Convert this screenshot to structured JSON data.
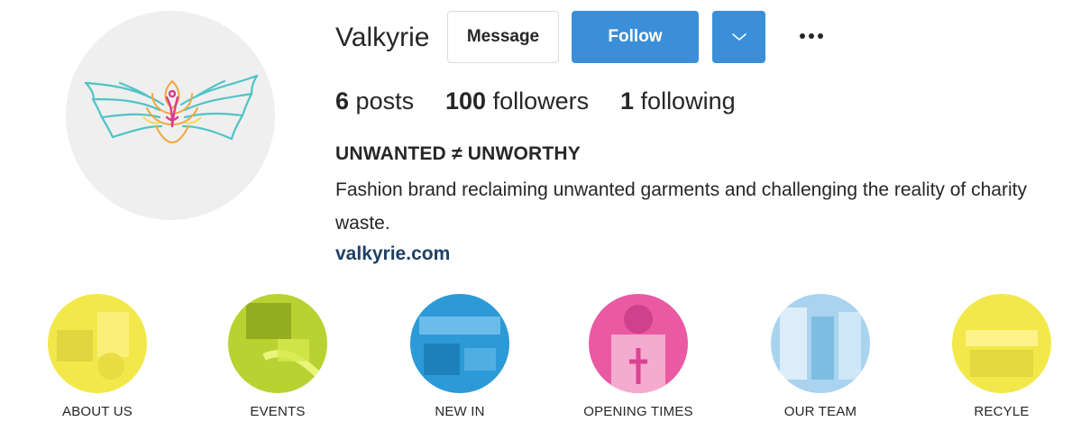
{
  "profile": {
    "username": "Valkyrie",
    "message_label": "Message",
    "follow_label": "Follow",
    "more_glyph": "•••",
    "stats": {
      "posts_count": "6",
      "posts_label": "posts",
      "followers_count": "100",
      "followers_label": "followers",
      "following_count": "1",
      "following_label": "following"
    },
    "bio_title": "UNWANTED ≠ UNWORTHY",
    "bio_text": "Fashion brand reclaiming unwanted garments and challenging the reality of charity waste.",
    "website": "valkyrie.com"
  },
  "highlights": [
    {
      "label": "ABOUT US",
      "color": "#f2e84a"
    },
    {
      "label": "EVENTS",
      "color": "#b8d231"
    },
    {
      "label": "NEW IN",
      "color": "#2c9ad6"
    },
    {
      "label": "OPENING TIMES",
      "color": "#e95aa3"
    },
    {
      "label": "OUR TEAM",
      "color": "#a9d3ee"
    },
    {
      "label": "RECYLE",
      "color": "#f2e84a"
    }
  ],
  "colors": {
    "follow_blue": "#3b8fd8",
    "link": "#1f3f66",
    "avatar_bg": "#efefef"
  }
}
